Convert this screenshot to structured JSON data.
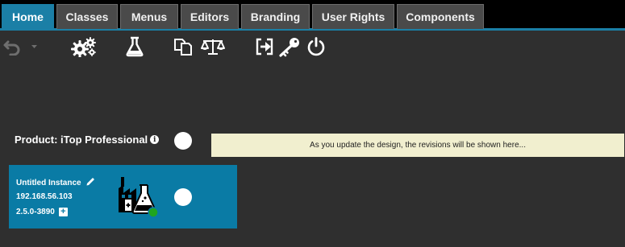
{
  "tabs": [
    {
      "label": "Home",
      "active": true
    },
    {
      "label": "Classes",
      "active": false
    },
    {
      "label": "Menus",
      "active": false
    },
    {
      "label": "Editors",
      "active": false
    },
    {
      "label": "Branding",
      "active": false
    },
    {
      "label": "User Rights",
      "active": false
    },
    {
      "label": "Components",
      "active": false
    }
  ],
  "toolbar": {
    "icons": [
      "undo-icon",
      "dropdown-caret-icon",
      "cogs-icon",
      "flask-icon",
      "copy-icon",
      "balance-scale-icon",
      "sign-in-icon",
      "key-icon",
      "power-icon"
    ]
  },
  "product": {
    "label": "Product: iTop Professional",
    "info_glyph": "i"
  },
  "revisions": {
    "message": "As you update the design, the revisions will be shown here..."
  },
  "instance": {
    "name": "Untitled Instance",
    "ip": "192.168.56.103",
    "version": "2.5.0-3890",
    "add_glyph": "+",
    "status_color": "#1fa51f"
  },
  "colors": {
    "accent": "#1b7fa6",
    "background": "#2f2f2f",
    "tab_inactive": "#4a4a4a",
    "revisions_bg": "#f1efcf"
  }
}
